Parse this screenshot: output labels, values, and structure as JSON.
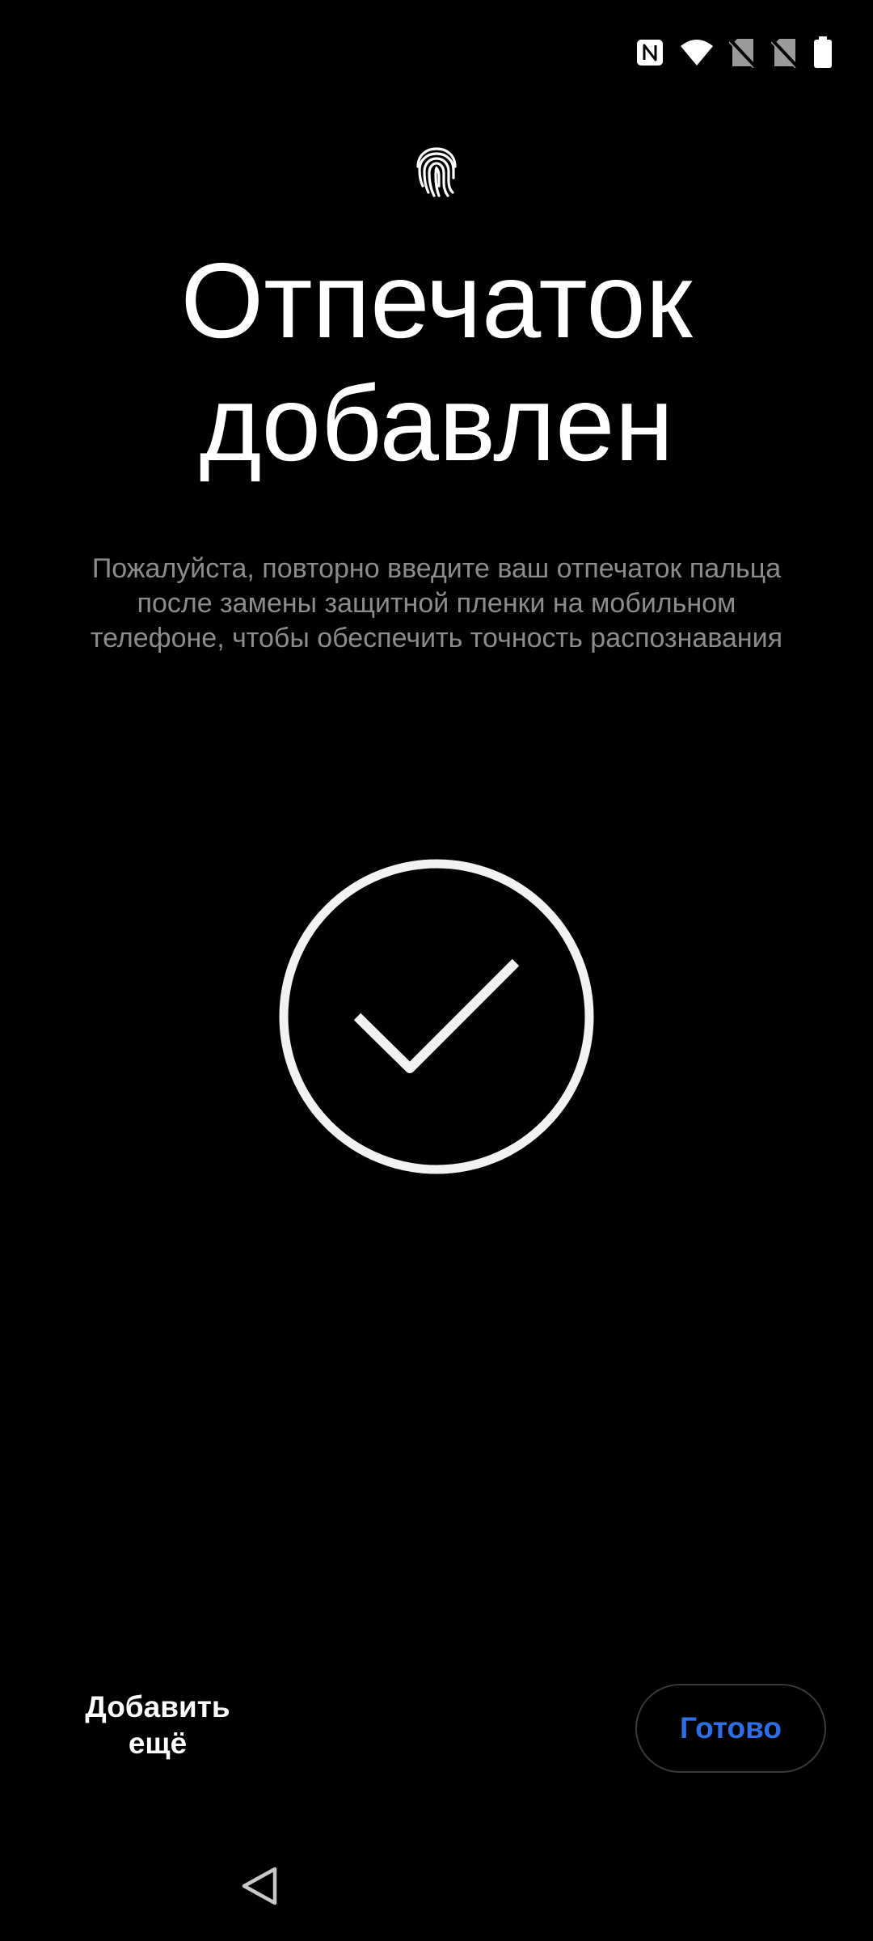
{
  "status_bar": {
    "icons": [
      "nfc-icon",
      "wifi-icon",
      "no-sim-icon",
      "no-sim-icon",
      "battery-icon"
    ]
  },
  "header": {
    "icon": "fingerprint-icon",
    "title_line1": "Отпечаток",
    "title_line2": "добавлен"
  },
  "message": "Пожалуйста, повторно введите ваш отпечаток пальца после замены защитной пленки на мобильном телефоне, чтобы обеспечить точность распознавания",
  "result_icon": "check-circle-icon",
  "actions": {
    "add_more_line1": "Добавить",
    "add_more_line2": "ещё",
    "done_label": "Готово"
  },
  "navigation": {
    "back_icon": "back-triangle-icon"
  },
  "colors": {
    "background": "#000000",
    "accent": "#2f6fe6",
    "secondary_text": "#8c8c8c"
  }
}
